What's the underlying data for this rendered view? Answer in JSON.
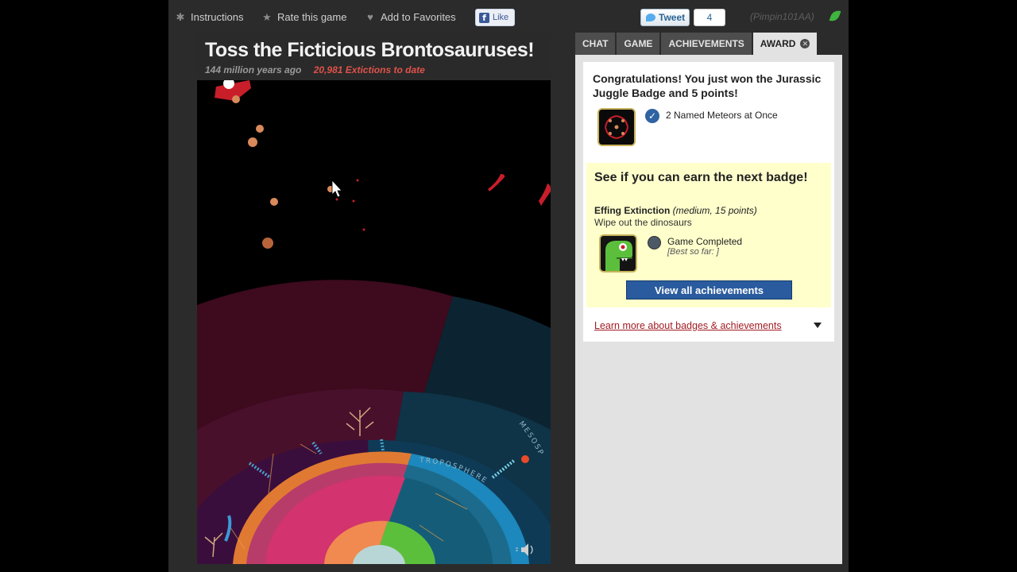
{
  "topbar": {
    "instructions": "Instructions",
    "rate": "Rate this game",
    "favorites": "Add to Favorites",
    "like": "Like",
    "tweet": "Tweet",
    "tweet_count": "4",
    "username": "(Pimpin101AA)"
  },
  "game": {
    "title": "Toss the Ficticious Brontosauruses!",
    "time": "144 million years ago",
    "extinctions": "20,981 Extictions to date",
    "ring_labels": [
      "TROPOSPHERE",
      "MESOSP"
    ]
  },
  "panel": {
    "tabs": [
      "CHAT",
      "GAME",
      "ACHIEVEMENTS",
      "AWARD"
    ],
    "active_tab": "AWARD",
    "award": {
      "congrats": "Congratulations! You just won the Jurassic Juggle Badge and 5 points!",
      "criterion": "2 Named Meteors at Once"
    },
    "next": {
      "title": "See if you can earn the next badge!",
      "name": "Effing Extinction",
      "meta": "(medium, 15 points)",
      "description": "Wipe out the dinosaurs",
      "criterion": "Game Completed",
      "best": "[Best so far: ]",
      "button": "View all achievements"
    },
    "learn_more": "Learn more about badges & achievements"
  },
  "colors": {
    "accent_red": "#e0524a",
    "button_blue": "#2a5b9e",
    "highlight_yellow": "#ffffcc",
    "link_red": "#a21c24"
  }
}
